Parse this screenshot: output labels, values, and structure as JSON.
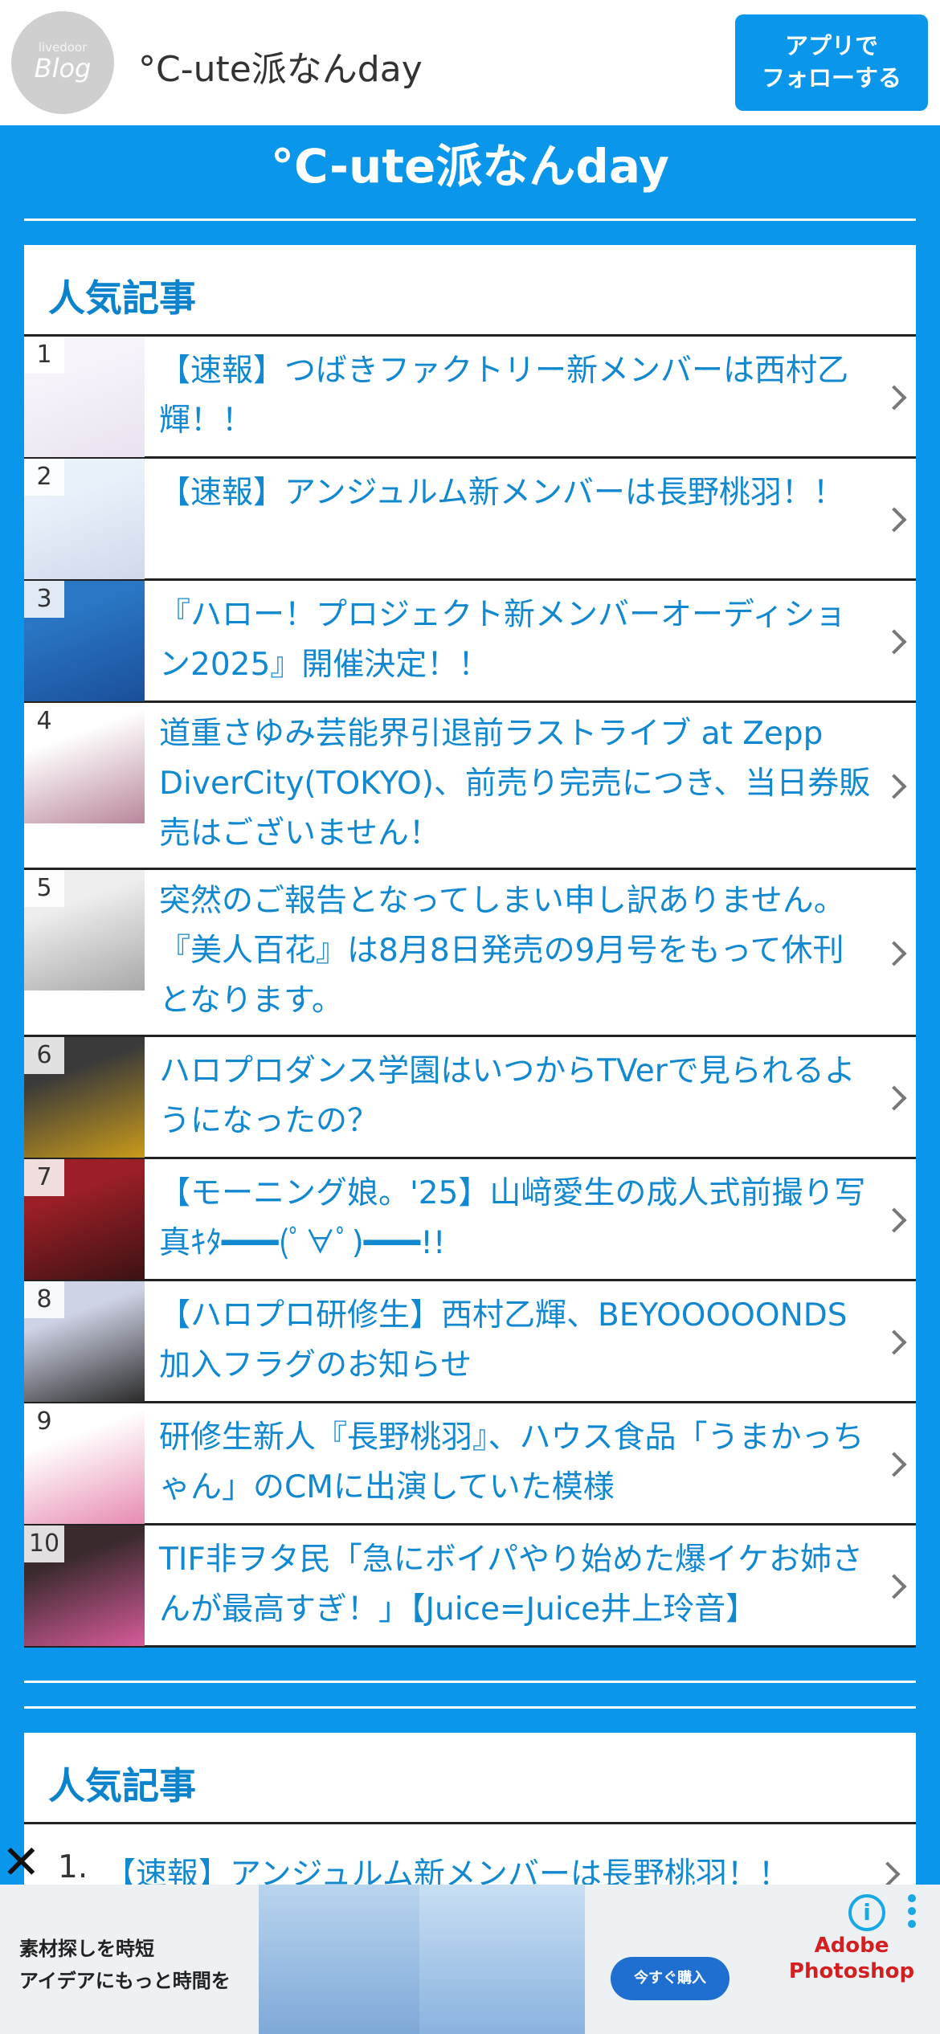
{
  "header": {
    "avatar_small": "livedoor",
    "avatar_big": "Blog",
    "blog_name": "°C-ute派なんday",
    "follow_button": "アプリで\nフォローする"
  },
  "site_title": "°C-ute派なんday",
  "ranking": {
    "heading": "人気記事",
    "items": [
      {
        "rank": "1",
        "title": "【速報】つばきファクトリー新メンバーは西村乙輝！！",
        "thumb_colors": [
          "#f7f3fb",
          "#e9e2ef"
        ]
      },
      {
        "rank": "2",
        "title": "【速報】アンジュルム新メンバーは長野桃羽！！",
        "thumb_colors": [
          "#e9f1fb",
          "#cfd9ea"
        ]
      },
      {
        "rank": "3",
        "title": "『ハロー！プロジェクト新メンバーオーディション2025』開催決定！！",
        "thumb_colors": [
          "#2a76c4",
          "#1a4f9a"
        ]
      },
      {
        "rank": "4",
        "title": "道重さゆみ芸能界引退前ラストライブ at Zepp DiverCity(TOKYO)、前売り完売につき、当日券販売はございません！",
        "thumb_colors": [
          "#ffffff",
          "#b9869c"
        ]
      },
      {
        "rank": "5",
        "title": "突然のご報告となってしまい申し訳ありません。『美人百花』は8月8日発売の9月号をもって休刊となります。",
        "thumb_colors": [
          "#efeeee",
          "#a8a8a8"
        ]
      },
      {
        "rank": "6",
        "title": "ハロプロダンス学園はいつからTVerで見られるようになったの？",
        "thumb_colors": [
          "#3a3a3a",
          "#c99a1a"
        ]
      },
      {
        "rank": "7",
        "title": "【モーニング娘。'25】山﨑愛生の成人式前撮り写真ｷﾀ━━━(ﾟ∀ﾟ)━━━!!",
        "thumb_colors": [
          "#9c1f27",
          "#3c1214"
        ]
      },
      {
        "rank": "8",
        "title": "【ハロプロ研修生】西村乙輝、BEYOOOOONDS加入フラグのお知らせ",
        "thumb_colors": [
          "#cfd3e6",
          "#2b2b2b"
        ]
      },
      {
        "rank": "9",
        "title": "研修生新人『長野桃羽』、ハウス食品「うまかっちゃん」のCMに出演していた模様",
        "thumb_colors": [
          "#ffffff",
          "#e78bb2"
        ]
      },
      {
        "rank": "10",
        "title": "TIF非ヲタ民「急にボイパやり始めた爆イケお姉さんが最高すぎ！」【Juice=Juice井上玲音】",
        "thumb_colors": [
          "#3a2a2e",
          "#d75b9a"
        ]
      }
    ]
  },
  "ranking2": {
    "heading": "人気記事",
    "items": [
      {
        "rank": "1.",
        "title": "【速報】アンジュルム新メンバーは長野桃羽！！"
      }
    ]
  },
  "ad": {
    "copy": "素材探しを時短\nアイデアにもっと時間を",
    "button": "今すぐ購入",
    "brand": "Adobe\nPhotoshop",
    "info_icon": "i",
    "close_icon": "✕"
  },
  "colors": {
    "brand_blue": "#0a96ea",
    "link_blue": "#1188d0"
  }
}
